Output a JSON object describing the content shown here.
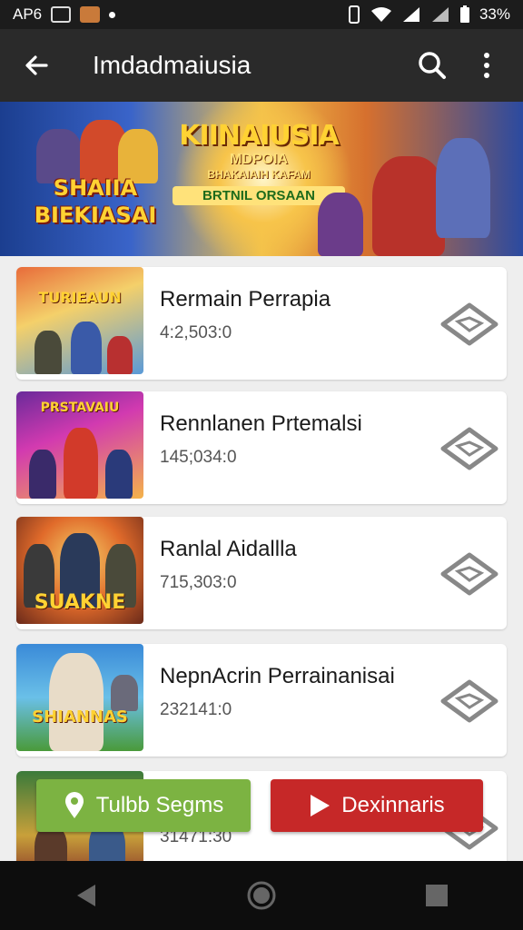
{
  "status_bar": {
    "carrier": "AP6",
    "battery": "33%",
    "icons": [
      "image-icon",
      "app-icon",
      "wifi-icon",
      "signal-icon",
      "battery-icon"
    ]
  },
  "app_bar": {
    "title": "Imdadmaiusia",
    "icons": [
      "back-arrow-icon",
      "search-icon",
      "more-vert-icon"
    ]
  },
  "banner": {
    "left_text_line1": "SHAIIA",
    "left_text_line2": "BIEKIASAI",
    "center_title_line1": "KIINAIUSIA",
    "center_title_line2": "MDPOIA",
    "center_sub": "BHAKAIAIH KAFAM",
    "center_sub2": "BRTNIL ORSAAN"
  },
  "items": [
    {
      "title": "Rermain Perrapia",
      "count": "4:2,503:0",
      "thumb_text": "TURIEAUN",
      "icon": "diamond-tag-icon"
    },
    {
      "title": "Rennlanen Prtemalsi",
      "count": "145;034:0",
      "thumb_text": "PRSTAVAIU",
      "icon": "diamond-tag-icon"
    },
    {
      "title": "Ranlal Aidallla",
      "count": "715,303:0",
      "thumb_text": "SUAKNE",
      "icon": "diamond-tag-icon"
    },
    {
      "title": "NepnAcrin Perrainanisai",
      "count": "232141:0",
      "thumb_text": "SHIANNAS",
      "icon": "diamond-tag-icon"
    },
    {
      "title": "",
      "count": "31471:30",
      "thumb_text": "",
      "icon": "diamond-tag-icon"
    }
  ],
  "bottom_buttons": {
    "green_label": "Tulbb Segms",
    "green_icon": "location-pin-icon",
    "red_label": "Dexinnaris",
    "red_icon": "play-icon"
  },
  "nav_bar": {
    "icons": [
      "nav-back-icon",
      "nav-home-icon",
      "nav-recents-icon"
    ]
  },
  "colors": {
    "app_bar": "#2a2a2a",
    "green_button": "#7cb342",
    "red_button": "#c62828",
    "background": "#eeeeee"
  }
}
